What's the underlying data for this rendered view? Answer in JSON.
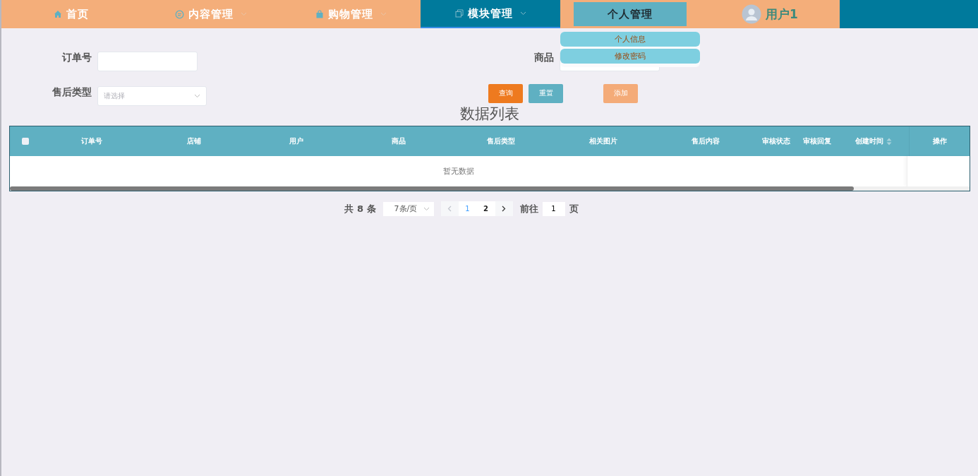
{
  "nav": {
    "items": [
      {
        "label": "首页",
        "has_menu": false,
        "selected": false,
        "expanded": false
      },
      {
        "label": "内容管理",
        "has_menu": true,
        "selected": false,
        "expanded": false
      },
      {
        "label": "购物管理",
        "has_menu": true,
        "selected": false,
        "expanded": false
      },
      {
        "label": "模块管理",
        "has_menu": true,
        "selected": true,
        "expanded": false
      },
      {
        "label": "个人管理",
        "has_menu": false,
        "selected": false,
        "expanded": true,
        "menu": [
          "个人信息",
          "修改密码"
        ]
      }
    ],
    "user": "用户1"
  },
  "search": {
    "fields": [
      {
        "label": "订单号",
        "kind": "input"
      },
      {
        "label": "商品",
        "kind": "input"
      },
      {
        "label": "售后类型",
        "kind": "select",
        "placeholder": "请选择"
      }
    ],
    "buttons": [
      {
        "label": "查询",
        "kind": "primary"
      },
      {
        "label": "重置",
        "kind": "secondary"
      },
      {
        "label": "添加",
        "kind": "add"
      }
    ]
  },
  "table": {
    "title": "数据列表",
    "select_all_checked": false,
    "columns": [
      {
        "label": "订单号",
        "sortable": false
      },
      {
        "label": "店铺",
        "sortable": false
      },
      {
        "label": "用户",
        "sortable": false
      },
      {
        "label": "商品",
        "sortable": false
      },
      {
        "label": "售后类型",
        "sortable": false
      },
      {
        "label": "相关图片",
        "sortable": false
      },
      {
        "label": "售后内容",
        "sortable": false
      },
      {
        "label": "审核状态",
        "sortable": false
      },
      {
        "label": "审核回复",
        "sortable": false
      },
      {
        "label": "创建时间",
        "sortable": true
      },
      {
        "label": "操作",
        "sortable": false
      }
    ],
    "empty_text": "暂无数据"
  },
  "pagination": {
    "total": "共 8 条",
    "page_size": "7条/页",
    "pages": [
      {
        "label": "1",
        "selected": true
      },
      {
        "label": "2",
        "selected": false
      }
    ],
    "goto_label": "前往",
    "goto_value": "1",
    "goto_suffix": "页"
  }
}
